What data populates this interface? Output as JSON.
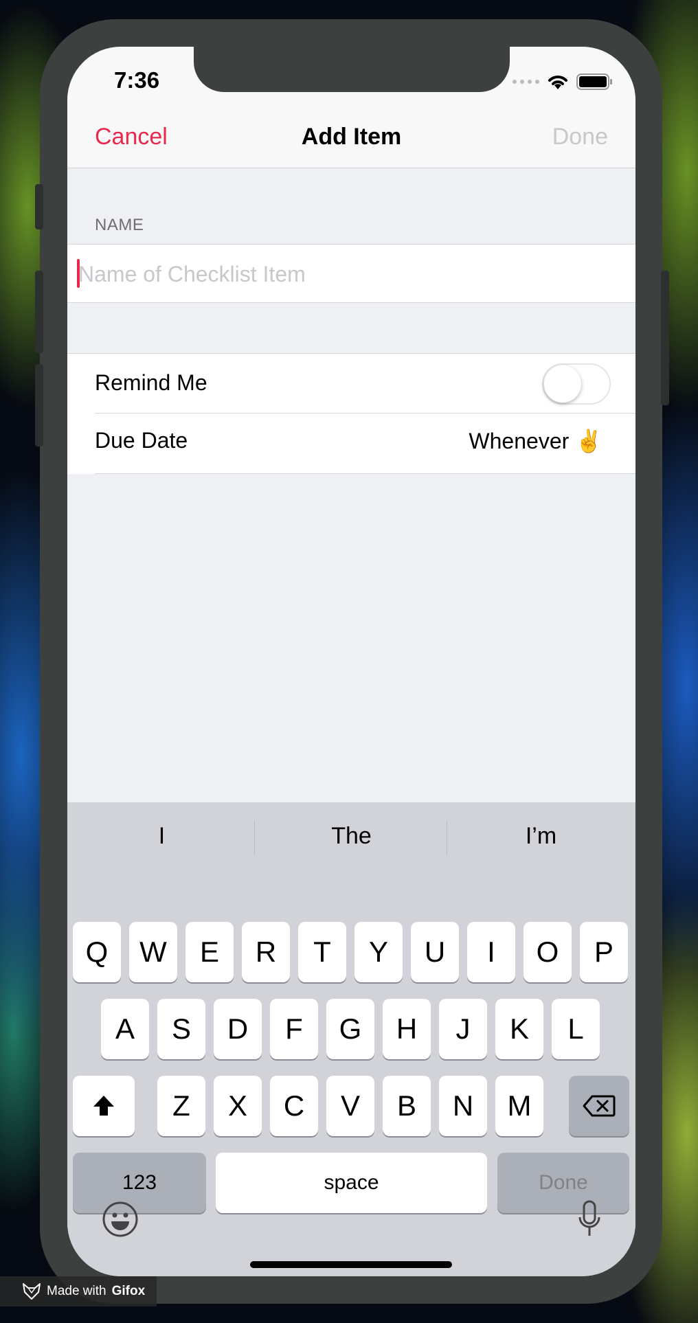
{
  "status": {
    "time": "7:36"
  },
  "nav": {
    "cancel": "Cancel",
    "title": "Add Item",
    "done": "Done"
  },
  "form": {
    "section_label": "NAME",
    "name_placeholder": "Name of Checklist Item",
    "name_value": "",
    "remind_label": "Remind Me",
    "remind_on": false,
    "due_label": "Due Date",
    "due_value": "Whenever ✌️"
  },
  "keyboard": {
    "suggestions": [
      "I",
      "The",
      "I’m"
    ],
    "row1": [
      "Q",
      "W",
      "E",
      "R",
      "T",
      "Y",
      "U",
      "I",
      "O",
      "P"
    ],
    "row2": [
      "A",
      "S",
      "D",
      "F",
      "G",
      "H",
      "J",
      "K",
      "L"
    ],
    "row3": [
      "Z",
      "X",
      "C",
      "V",
      "B",
      "N",
      "M"
    ],
    "numbers_key": "123",
    "space_key": "space",
    "done_key": "Done"
  },
  "watermark": {
    "prefix": "Made with",
    "brand": "Gifox"
  },
  "colors": {
    "accent": "#e7294e",
    "disabled": "#c8c8cc",
    "background": "#eff0f3"
  },
  "icons": [
    "signal-dots-icon",
    "wifi-icon",
    "battery-icon",
    "shift-icon",
    "backspace-icon",
    "emoji-icon",
    "microphone-icon",
    "gifox-logo-icon"
  ]
}
